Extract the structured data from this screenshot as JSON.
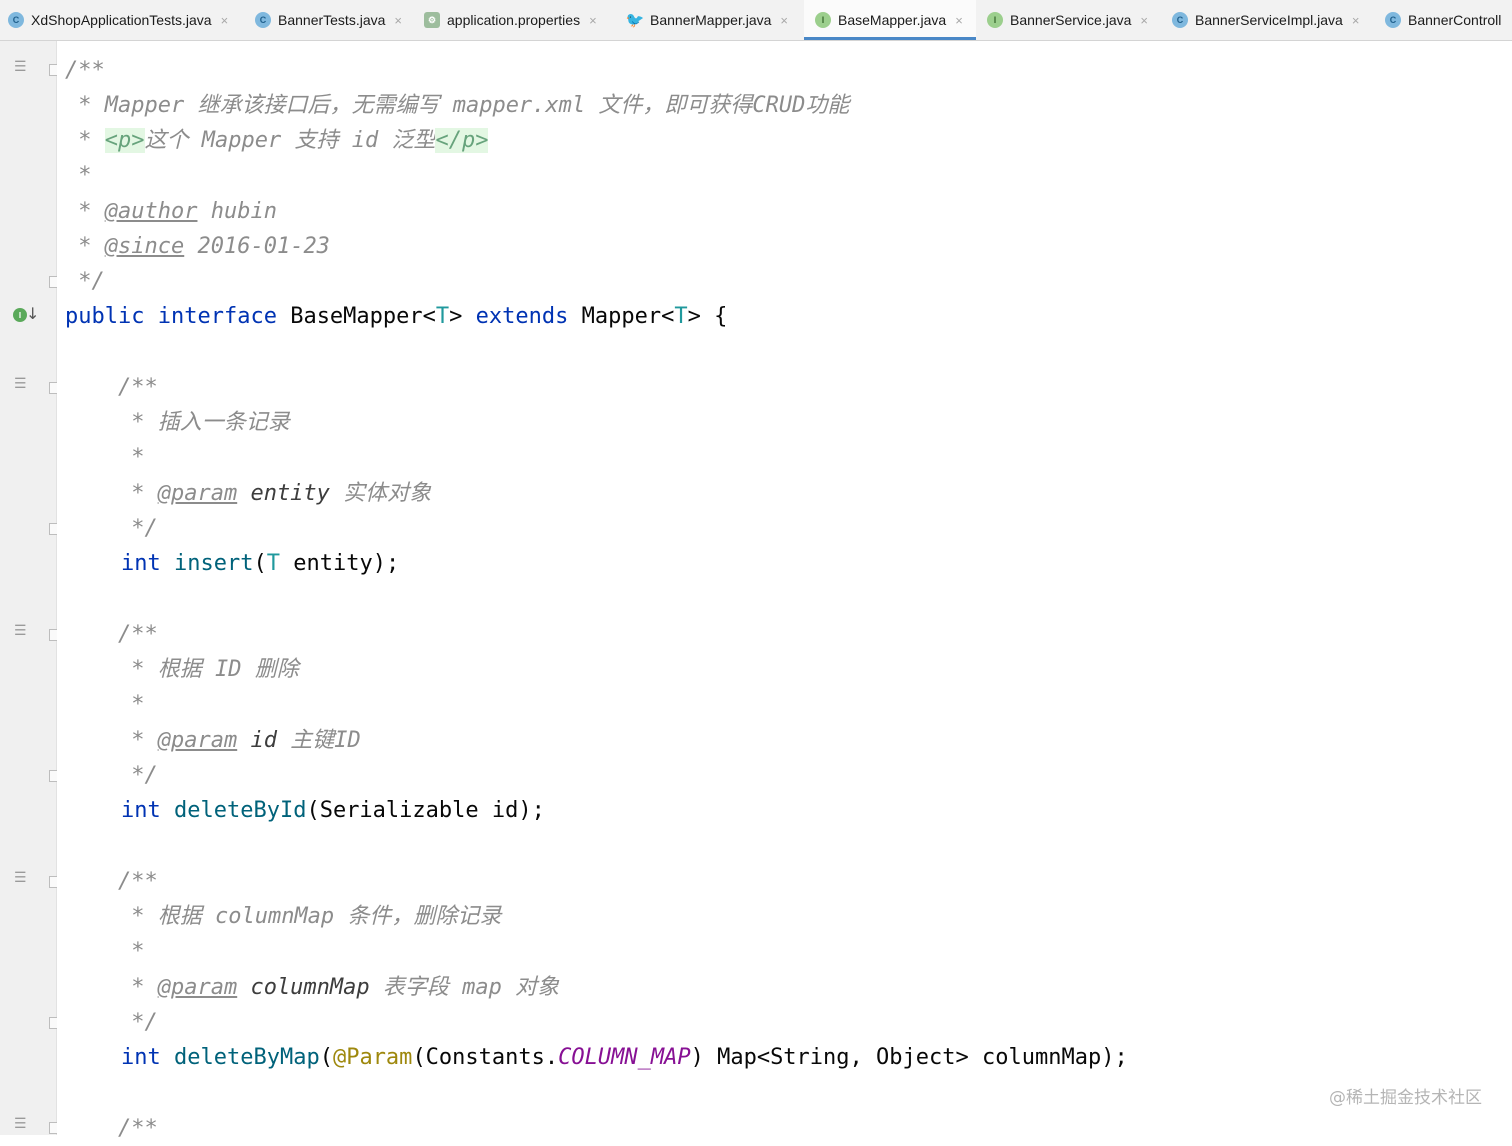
{
  "tabs": [
    {
      "label": "XdShopApplicationTests.java",
      "icon": "test-class-icon",
      "badge": "C"
    },
    {
      "label": "BannerTests.java",
      "icon": "test-class-icon",
      "badge": "C"
    },
    {
      "label": "application.properties",
      "icon": "properties-file-icon",
      "badge": ""
    },
    {
      "label": "BannerMapper.java",
      "icon": "mybatis-mapper-icon",
      "badge": ""
    },
    {
      "label": "BaseMapper.java",
      "icon": "interface-icon",
      "badge": "I",
      "active": true
    },
    {
      "label": "BannerService.java",
      "icon": "interface-icon",
      "badge": "I"
    },
    {
      "label": "BannerServiceImpl.java",
      "icon": "class-icon",
      "badge": "C"
    },
    {
      "label": "BannerControll",
      "icon": "class-icon",
      "badge": "C"
    }
  ],
  "close_glyph": "×",
  "code": {
    "l1": "/**",
    "l2_star": " * ",
    "l2_a": "Mapper 继承该接口后，无需编写 mapper.xml 文件，即可获得CRUD功能",
    "l3_star": " * ",
    "l3_open": "<p>",
    "l3_mid": "这个 Mapper 支持 id 泛型",
    "l3_close": "</p>",
    "l4": " *",
    "l5_star": " * ",
    "l5_tag": "@author",
    "l5_val": " hubin",
    "l6_star": " * ",
    "l6_tag": "@since",
    "l6_val": " 2016-01-23",
    "l7": " */",
    "l8_public": "public",
    "l8_interface": "interface",
    "l8_name": " BaseMapper<",
    "l8_T1": "T",
    "l8_gt": "> ",
    "l8_extends": "extends",
    "l8_mapper": " Mapper<",
    "l8_T2": "T",
    "l8_end": "> {",
    "c1_open": "    /**",
    "c1_desc_star": "     * ",
    "c1_desc": "插入一条记录",
    "c1_blank": "     *",
    "c1_param_star": "     * ",
    "c1_param_tag": "@param",
    "c1_param_name": " entity",
    "c1_param_desc": " 实体对象",
    "c1_close": "     */",
    "m1_int": "int",
    "m1_name": "insert",
    "m1_paren": "(",
    "m1_T": "T",
    "m1_rest": " entity);",
    "c2_open": "    /**",
    "c2_desc_star": "     * ",
    "c2_desc": "根据 ID 删除",
    "c2_blank": "     *",
    "c2_param_star": "     * ",
    "c2_param_tag": "@param",
    "c2_param_name": " id",
    "c2_param_desc": " 主键ID",
    "c2_close": "     */",
    "m2_int": "int",
    "m2_name": "deleteById",
    "m2_rest": "(Serializable id);",
    "c3_open": "    /**",
    "c3_desc_star": "     * ",
    "c3_desc": "根据 columnMap 条件，删除记录",
    "c3_blank": "     *",
    "c3_param_star": "     * ",
    "c3_param_tag": "@param",
    "c3_param_name": " columnMap",
    "c3_param_desc": " 表字段 map 对象",
    "c3_close": "     */",
    "m3_int": "int",
    "m3_name": "deleteByMap",
    "m3_paren": "(",
    "m3_anno": "@Param",
    "m3_p2": "(Constants.",
    "m3_const": "COLUMN_MAP",
    "m3_rest": ") Map<String, Object> columnMap);",
    "c4_open": "    /**"
  },
  "watermark": "@稀土掘金技术社区",
  "colors": {
    "keyword": "#0033b3",
    "method": "#00627a",
    "type_param": "#20999d",
    "comment": "#8c8c8c",
    "annotation": "#9e880d",
    "constant": "#871094",
    "tab_underline": "#4a88c7"
  }
}
